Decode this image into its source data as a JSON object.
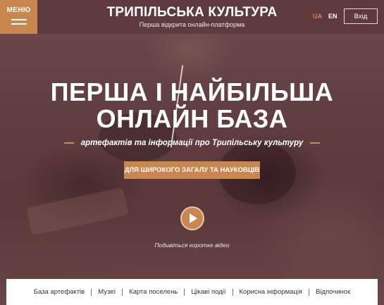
{
  "header": {
    "menu_label": "МЕНЮ",
    "brand_title": "ТРИПІЛЬСЬКА КУЛЬТУРА",
    "brand_subtitle": "Перша відкрита онлайн-платформа",
    "lang_ua": "UA",
    "lang_en": "EN",
    "login_label": "Вхід"
  },
  "hero": {
    "title_line1": "ПЕРША І НАЙБІЛЬША",
    "title_line2": "ОНЛАЙН БАЗА",
    "tagline": "артефактів та інформації про Трипільську культуру",
    "cta_label": "ДЛЯ ШИРОКОГО ЗАГАЛУ ТА НАУКОВЦІВ",
    "video_caption": "Подивіться коротке відео"
  },
  "nav": {
    "items": [
      {
        "label": "База артефактів"
      },
      {
        "label": "Музеї"
      },
      {
        "label": "Карта поселень"
      },
      {
        "label": "Цікаві події"
      },
      {
        "label": "Корисна інформація"
      },
      {
        "label": "Відпочинок"
      }
    ]
  },
  "colors": {
    "accent": "#c9864f",
    "header_bg": "#5e3a3e",
    "active_lang": "#d38a52"
  },
  "icons": {
    "menu": "hamburger-icon",
    "play": "play-icon"
  }
}
